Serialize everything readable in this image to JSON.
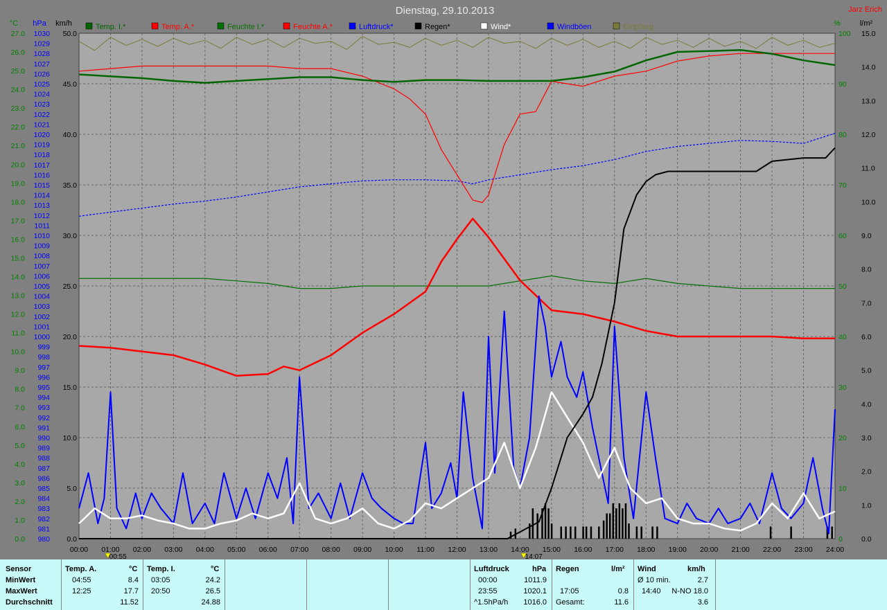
{
  "title": "Dienstag, 29.10.2013",
  "author": "Jarz Erich",
  "colors": {
    "temp_innen": "#006400",
    "temp_aussen": "#ff0000",
    "feuchte_innen": "#007000",
    "feuchte_aussen": "#ff0000",
    "luftdruck": "#0000ff",
    "regen": "#000000",
    "wind": "#ffffff",
    "windboeen": "#0000ff",
    "empfang": "#7a7a3a"
  },
  "axes": {
    "temp_unit": "°C",
    "press_unit": "hPa",
    "wind_unit": "km/h",
    "hum_unit": "%",
    "rain_unit": "l/m²",
    "temp_ticks": [
      "0.0",
      "1.0",
      "2.0",
      "3.0",
      "4.0",
      "5.0",
      "6.0",
      "7.0",
      "8.0",
      "9.0",
      "10.0",
      "11.0",
      "12.0",
      "13.0",
      "14.0",
      "15.0",
      "16.0",
      "17.0",
      "18.0",
      "19.0",
      "20.0",
      "21.0",
      "22.0",
      "23.0",
      "24.0",
      "25.0",
      "26.0",
      "27.0"
    ],
    "press_ticks": [
      "980",
      "981",
      "982",
      "983",
      "984",
      "985",
      "986",
      "987",
      "988",
      "989",
      "990",
      "991",
      "992",
      "993",
      "994",
      "995",
      "996",
      "997",
      "998",
      "999",
      "1000",
      "1001",
      "1002",
      "1003",
      "1004",
      "1005",
      "1006",
      "1007",
      "1008",
      "1009",
      "1010",
      "1011",
      "1012",
      "1013",
      "1014",
      "1015",
      "1016",
      "1017",
      "1018",
      "1019",
      "1020",
      "1021",
      "1022",
      "1023",
      "1024",
      "1025",
      "1026",
      "1027",
      "1028",
      "1029",
      "1030"
    ],
    "wind_ticks": [
      "0.0",
      "5.0",
      "10.0",
      "15.0",
      "20.0",
      "25.0",
      "30.0",
      "35.0",
      "40.0",
      "45.0",
      "50.0"
    ],
    "hum_ticks": [
      "0",
      "10",
      "20",
      "30",
      "40",
      "50",
      "60",
      "70",
      "80",
      "90",
      "100"
    ],
    "rain_ticks": [
      "0.0",
      "1.0",
      "2.0",
      "3.0",
      "4.0",
      "5.0",
      "6.0",
      "7.0",
      "8.0",
      "9.0",
      "10.0",
      "11.0",
      "12.0",
      "13.0",
      "14.0",
      "15.0"
    ],
    "time_ticks": [
      "00:00",
      "01:00",
      "02:00",
      "03:00",
      "04:00",
      "05:00",
      "06:00",
      "07:00",
      "08:00",
      "09:00",
      "10:00",
      "11:00",
      "12:00",
      "13:00",
      "14:00",
      "15:00",
      "16:00",
      "17:00",
      "18:00",
      "19:00",
      "20:00",
      "21:00",
      "22:00",
      "23:00",
      "24:00"
    ],
    "sun_markers": [
      {
        "label": "00:55",
        "hour": 0.9167
      },
      {
        "label": "14:07",
        "hour": 14.1167
      }
    ]
  },
  "chart_data": {
    "type": "line",
    "title": "Dienstag, 29.10.2013",
    "x_unit": "hours",
    "xlim": [
      0,
      24
    ],
    "ylim_temp": [
      0,
      27
    ],
    "ylim_press": [
      980,
      1030
    ],
    "ylim_wind": [
      0,
      50
    ],
    "ylim_hum": [
      0,
      100
    ],
    "ylim_rain": [
      0,
      15
    ],
    "grid": true,
    "legend_placement": "top",
    "series": [
      {
        "name": "Temp. I.*",
        "key": "temp_innen",
        "axis": "temp",
        "width": 2.5,
        "x": [
          0,
          1,
          2,
          3,
          4,
          5,
          6,
          7,
          8,
          9,
          10,
          11,
          12,
          13,
          14,
          15,
          16,
          17,
          18,
          19,
          20,
          21,
          22,
          23,
          24
        ],
        "y": [
          24.8,
          24.7,
          24.6,
          24.45,
          24.35,
          24.45,
          24.55,
          24.65,
          24.65,
          24.5,
          24.4,
          24.5,
          24.5,
          24.45,
          24.45,
          24.45,
          24.65,
          24.95,
          25.55,
          26.0,
          26.05,
          26.1,
          25.9,
          25.55,
          25.3
        ]
      },
      {
        "name": "Temp. A.*",
        "key": "temp_aussen",
        "axis": "temp",
        "width": 2.5,
        "x": [
          0,
          1,
          2,
          3,
          4,
          5,
          6,
          6.5,
          7,
          8,
          9,
          10,
          11,
          11.5,
          12,
          12.5,
          13,
          14,
          15,
          16,
          17,
          18,
          19,
          20,
          21,
          22,
          23,
          24
        ],
        "y": [
          10.3,
          10.2,
          10.0,
          9.8,
          9.3,
          8.7,
          8.8,
          9.2,
          9.0,
          9.8,
          11.0,
          12.0,
          13.2,
          14.8,
          16.0,
          17.1,
          16.1,
          13.8,
          12.2,
          12.0,
          11.6,
          11.1,
          10.8,
          10.8,
          10.8,
          10.8,
          10.7,
          10.7
        ]
      },
      {
        "name": "Feuchte I.*",
        "key": "feuchte_innen",
        "axis": "hum",
        "width": 1.2,
        "x": [
          0,
          1,
          2,
          3,
          4,
          5,
          6,
          7,
          8,
          9,
          10,
          11,
          12,
          13,
          14,
          15,
          16,
          17,
          18,
          19,
          20,
          21,
          22,
          23,
          24
        ],
        "y": [
          51.5,
          51.5,
          51.5,
          51.5,
          51.5,
          51.0,
          50.5,
          49.5,
          49.5,
          50.0,
          50.0,
          50.0,
          50.0,
          50.0,
          51.0,
          52.0,
          51.0,
          50.5,
          51.5,
          50.5,
          50.0,
          49.5,
          49.5,
          49.5,
          49.5
        ]
      },
      {
        "name": "Feuchte A.*",
        "key": "feuchte_aussen",
        "axis": "hum",
        "width": 1.2,
        "x": [
          0,
          1,
          2,
          3,
          4,
          5,
          6,
          7,
          8,
          9,
          10,
          10.5,
          11,
          11.5,
          12,
          12.5,
          12.8,
          13,
          13.5,
          14,
          14.5,
          15,
          16,
          17,
          18,
          19,
          20,
          21,
          22,
          23,
          24
        ],
        "y": [
          92.5,
          93.0,
          93.5,
          93.5,
          93.5,
          93.5,
          93.5,
          93.0,
          93.0,
          91.5,
          89.0,
          87.0,
          84.0,
          77.0,
          72.0,
          67.0,
          66.5,
          68.0,
          78.0,
          84.0,
          84.5,
          90.5,
          89.5,
          91.5,
          92.5,
          94.5,
          95.5,
          96.0,
          96.0,
          96.0,
          96.0
        ]
      },
      {
        "name": "Luftdruck*",
        "key": "luftdruck",
        "axis": "press",
        "width": 1.2,
        "dash": "3,2",
        "x": [
          0,
          1,
          2,
          3,
          4,
          5,
          6,
          7,
          8,
          9,
          10,
          11,
          12,
          12.5,
          13,
          14,
          15,
          16,
          17,
          18,
          19,
          20,
          21,
          22,
          23,
          24
        ],
        "y": [
          1011.9,
          1012.3,
          1012.7,
          1013.1,
          1013.4,
          1013.8,
          1014.3,
          1014.8,
          1015.1,
          1015.4,
          1015.5,
          1015.5,
          1015.4,
          1015.1,
          1015.5,
          1016.0,
          1016.5,
          1016.9,
          1017.5,
          1018.3,
          1018.8,
          1019.1,
          1019.4,
          1019.3,
          1019.1,
          1020.1
        ]
      },
      {
        "name": "Regen*",
        "key": "regen",
        "axis": "rain",
        "width": 2,
        "x": [
          0,
          13.6,
          14.2,
          14.6,
          15.0,
          15.5,
          16.0,
          16.3,
          16.6,
          17.0,
          17.3,
          17.7,
          18.0,
          18.3,
          18.7,
          19.5,
          20,
          21,
          21.5,
          22,
          23,
          23.7,
          24
        ],
        "y": [
          0,
          0,
          0.3,
          0.5,
          1.5,
          3.0,
          3.7,
          4.2,
          5.2,
          7.0,
          9.2,
          10.2,
          10.6,
          10.8,
          10.9,
          10.9,
          10.9,
          10.9,
          10.9,
          11.2,
          11.3,
          11.3,
          11.6
        ]
      },
      {
        "name": "Wind*",
        "key": "wind",
        "axis": "wind",
        "width": 2.5,
        "x": [
          0,
          0.5,
          1,
          1.5,
          2,
          2.5,
          3,
          3.5,
          4,
          4.5,
          5,
          5.5,
          6,
          6.5,
          7,
          7.5,
          8,
          8.5,
          9,
          9.5,
          10,
          10.5,
          11,
          11.5,
          12,
          12.5,
          13,
          13.5,
          14,
          14.5,
          15,
          15.5,
          16,
          16.5,
          17,
          17.5,
          18,
          18.5,
          19,
          19.5,
          20,
          20.5,
          21,
          21.5,
          22,
          22.5,
          23,
          23.5,
          24
        ],
        "y": [
          1.5,
          3.0,
          2.0,
          2.0,
          2.3,
          1.8,
          1.5,
          1.0,
          1.0,
          1.5,
          1.8,
          2.5,
          2.0,
          2.5,
          5.5,
          2.0,
          1.5,
          2.0,
          3.0,
          1.5,
          1.0,
          1.8,
          3.5,
          3.0,
          4.0,
          5.0,
          6.0,
          9.5,
          5.0,
          9.0,
          14.5,
          12.0,
          9.5,
          6.0,
          9.0,
          5.0,
          3.5,
          4.0,
          2.0,
          1.5,
          1.5,
          1.0,
          0.8,
          1.5,
          3.5,
          2.0,
          4.5,
          2.0,
          2.7
        ]
      },
      {
        "name": "Windböen",
        "key": "windboeen",
        "axis": "wind",
        "width": 2,
        "x": [
          0,
          0.3,
          0.6,
          0.8,
          1.0,
          1.2,
          1.5,
          1.8,
          2.0,
          2.3,
          2.6,
          3.0,
          3.3,
          3.6,
          4.0,
          4.3,
          4.6,
          5.0,
          5.3,
          5.6,
          6.0,
          6.3,
          6.6,
          6.8,
          7.0,
          7.3,
          7.6,
          8.0,
          8.3,
          8.6,
          9.0,
          9.3,
          9.6,
          10.0,
          10.3,
          10.6,
          11.0,
          11.2,
          11.5,
          11.8,
          12.0,
          12.2,
          12.5,
          12.8,
          13.0,
          13.2,
          13.5,
          13.8,
          14.0,
          14.3,
          14.6,
          14.8,
          15.0,
          15.3,
          15.5,
          15.8,
          16.0,
          16.3,
          16.5,
          16.8,
          17.0,
          17.3,
          17.6,
          18.0,
          18.3,
          18.6,
          19.0,
          19.3,
          19.6,
          20.0,
          20.3,
          20.6,
          21.0,
          21.3,
          21.6,
          22.0,
          22.3,
          22.6,
          23.0,
          23.3,
          23.6,
          23.8,
          24
        ],
        "y": [
          3.0,
          6.5,
          1.5,
          4.0,
          14.5,
          3.0,
          1.0,
          4.5,
          2.0,
          4.5,
          3.0,
          1.5,
          6.5,
          1.5,
          3.5,
          1.5,
          6.5,
          2.0,
          5.0,
          2.0,
          6.5,
          4.0,
          8.0,
          1.5,
          16.0,
          3.0,
          4.5,
          2.0,
          5.5,
          2.0,
          6.5,
          4.0,
          3.0,
          2.0,
          1.5,
          1.5,
          9.5,
          3.0,
          4.5,
          7.5,
          4.0,
          14.5,
          6.0,
          1.0,
          20.0,
          6.5,
          22.5,
          7.0,
          5.0,
          10.0,
          24.0,
          21.0,
          16.0,
          19.5,
          16.0,
          14.0,
          16.5,
          11.0,
          8.0,
          3.5,
          21.0,
          8.0,
          2.0,
          14.5,
          8.0,
          2.0,
          1.5,
          3.5,
          2.0,
          1.5,
          3.0,
          1.5,
          2.0,
          3.5,
          1.5,
          6.5,
          3.0,
          2.0,
          3.5,
          8.0,
          3.0,
          0.5,
          12.8
        ]
      },
      {
        "name": "Empfang",
        "key": "empfang",
        "axis": "wind",
        "width": 1,
        "x": [
          0,
          0.5,
          1,
          1.5,
          2,
          2.5,
          3,
          3.5,
          4,
          4.5,
          5,
          5.5,
          6,
          6.5,
          7,
          7.5,
          8,
          8.5,
          9,
          9.5,
          10,
          10.5,
          11,
          11.5,
          12,
          12.5,
          13,
          13.5,
          14,
          14.5,
          15,
          15.5,
          16,
          16.5,
          17,
          17.5,
          18,
          18.5,
          19,
          19.5,
          20,
          20.5,
          21,
          21.5,
          22,
          22.5,
          23,
          23.5,
          24
        ],
        "y": [
          49.2,
          48.3,
          49.6,
          48.8,
          49.4,
          48.7,
          49.5,
          48.9,
          49.3,
          48.5,
          49.6,
          48.9,
          49.4,
          48.6,
          49.5,
          49.0,
          49.2,
          48.4,
          49.7,
          48.9,
          49.1,
          48.6,
          49.5,
          48.8,
          49.3,
          48.6,
          49.6,
          49.0,
          49.2,
          48.5,
          49.5,
          48.8,
          49.4,
          48.6,
          49.2,
          48.5,
          49.6,
          48.9,
          49.3,
          48.6,
          49.5,
          48.7,
          49.2,
          48.5,
          49.6,
          48.8,
          49.3,
          48.6,
          49.0
        ]
      }
    ],
    "rain_bars": [
      {
        "x": 13.7,
        "v": 0.7
      },
      {
        "x": 13.85,
        "v": 1.0
      },
      {
        "x": 14.3,
        "v": 1.5
      },
      {
        "x": 14.4,
        "v": 3.0
      },
      {
        "x": 14.55,
        "v": 2.5
      },
      {
        "x": 14.7,
        "v": 3.0
      },
      {
        "x": 14.8,
        "v": 3.5
      },
      {
        "x": 14.9,
        "v": 3.0
      },
      {
        "x": 15.0,
        "v": 1.5
      },
      {
        "x": 15.3,
        "v": 1.2
      },
      {
        "x": 15.45,
        "v": 1.2
      },
      {
        "x": 15.6,
        "v": 1.2
      },
      {
        "x": 15.75,
        "v": 1.2
      },
      {
        "x": 16.0,
        "v": 1.2
      },
      {
        "x": 16.1,
        "v": 1.2
      },
      {
        "x": 16.25,
        "v": 1.2
      },
      {
        "x": 16.5,
        "v": 1.2
      },
      {
        "x": 16.65,
        "v": 1.8
      },
      {
        "x": 16.75,
        "v": 2.5
      },
      {
        "x": 16.85,
        "v": 2.5
      },
      {
        "x": 16.95,
        "v": 3.5
      },
      {
        "x": 17.05,
        "v": 3.0
      },
      {
        "x": 17.15,
        "v": 3.5
      },
      {
        "x": 17.25,
        "v": 3.0
      },
      {
        "x": 17.35,
        "v": 3.5
      },
      {
        "x": 17.45,
        "v": 1.5
      },
      {
        "x": 17.7,
        "v": 1.2
      },
      {
        "x": 17.85,
        "v": 1.2
      },
      {
        "x": 18.2,
        "v": 1.2
      },
      {
        "x": 18.35,
        "v": 1.2
      },
      {
        "x": 21.95,
        "v": 1.2
      },
      {
        "x": 22.6,
        "v": 1.2
      },
      {
        "x": 23.75,
        "v": 1.2
      },
      {
        "x": 23.9,
        "v": 1.2
      }
    ]
  },
  "stats": {
    "row_labels": [
      "Sensor",
      "MinWert",
      "MaxWert",
      "Durchschnitt"
    ],
    "temp_a": {
      "header": "Temp. A.",
      "unit": "°C",
      "min_time": "04:55",
      "min_val": "8.4",
      "max_time": "12:25",
      "max_val": "17.7",
      "avg": "11.52"
    },
    "temp_i": {
      "header": "Temp. I.",
      "unit": "°C",
      "min_time": "03:05",
      "min_val": "24.2",
      "max_time": "20:50",
      "max_val": "26.5",
      "avg": "24.88"
    },
    "luftdruck": {
      "header": "Luftdruck",
      "unit": "hPa",
      "min_time": "00:00",
      "min_val": "1011.9",
      "max_time": "23:55",
      "max_val": "1020.1",
      "trend": "^1.5hPa/h",
      "avg": "1016.0"
    },
    "regen": {
      "header": "Regen",
      "unit": "l/m²",
      "max_time": "17:05",
      "max_val": "0.8",
      "total_label": "Gesamt:",
      "total": "11.6"
    },
    "wind": {
      "header": "Wind",
      "unit": "km/h",
      "avg10_label": "Ø 10 min.",
      "avg10": "2.7",
      "max_time": "14:40",
      "max_val": "N-NO 18.0",
      "avg": "3.6"
    }
  }
}
